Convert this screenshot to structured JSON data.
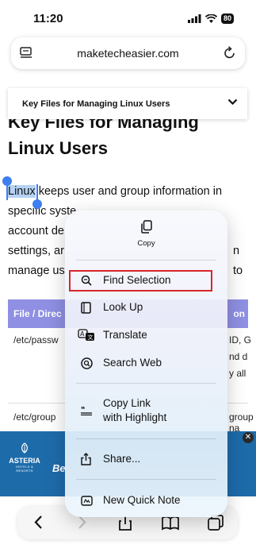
{
  "status_bar": {
    "time": "11:20",
    "battery": "80"
  },
  "browser": {
    "url": "maketecheasier.com"
  },
  "toc": {
    "label": "Key Files for Managing Linux Users"
  },
  "article": {
    "title_line1": "Key Files for Managing",
    "title_line2": "Linux Users",
    "selected_word": "Linux",
    "para_line1_rest": " keeps user and group information in",
    "para_line2": "specific syste",
    "para_line3": "account de",
    "para_line4": "settings, ar",
    "para_line4_end": "n to",
    "para_line5": "manage us"
  },
  "table": {
    "header_col1": "File / Direc",
    "header_col2": "on",
    "row1_col1": "/etc/passw",
    "row1_end_a": "ID, G",
    "row1_end_b": "nd d",
    "row1_end_c": "y all",
    "row2_col1": "/etc/group",
    "row2_end": "group na"
  },
  "ad": {
    "brand": "ASTERIA",
    "brand_sub": "HOTELS & RESORTS",
    "text": "Be"
  },
  "context_menu": {
    "copy": "Copy",
    "find_selection": "Find Selection",
    "look_up": "Look Up",
    "translate": "Translate",
    "search_web": "Search Web",
    "copy_link_line1": "Copy Link",
    "copy_link_line2": "with Highlight",
    "share": "Share...",
    "new_quick_note": "New Quick Note"
  },
  "colors": {
    "accent": "#3d7ef0",
    "table_header": "#8f8fe3",
    "highlight_border": "#d8262b",
    "ad_bg": "#1e6baa"
  }
}
